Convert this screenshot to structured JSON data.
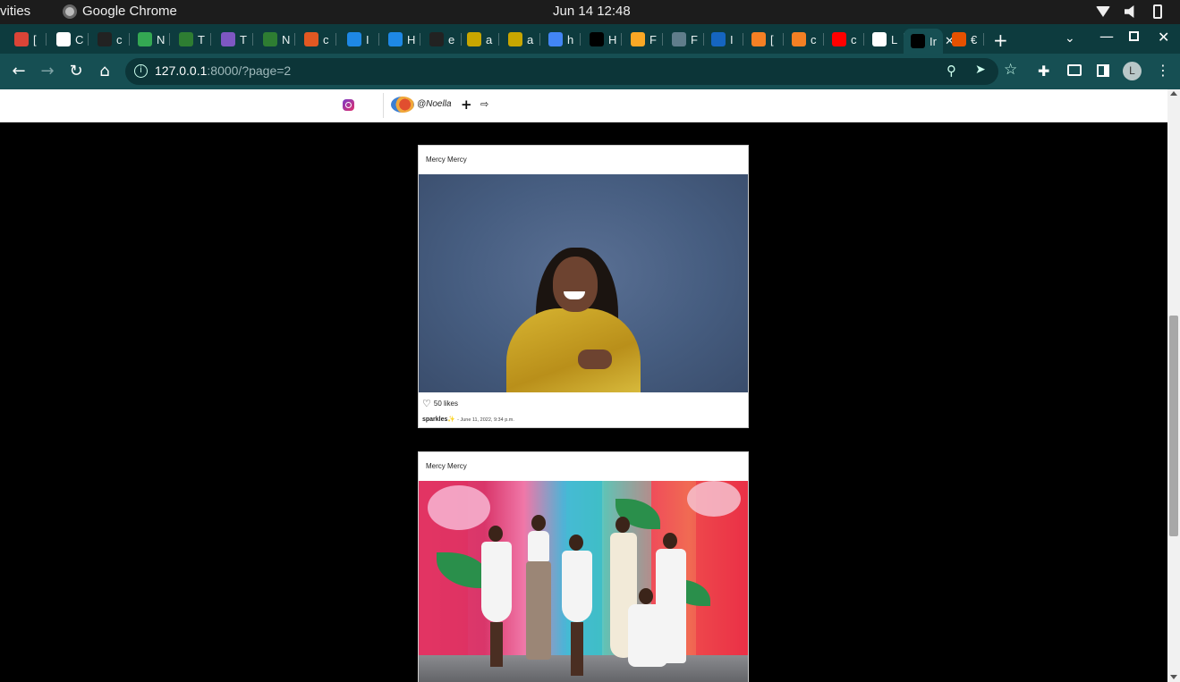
{
  "os": {
    "activities": "vities",
    "app_name": "Google Chrome",
    "clock": "Jun 14  12:48"
  },
  "tabs": [
    {
      "letter": "[",
      "color": "#db4437"
    },
    {
      "letter": "C",
      "color": "#ffffff"
    },
    {
      "letter": "c",
      "color": "#222222"
    },
    {
      "letter": "N",
      "color": "#34a853"
    },
    {
      "letter": "T",
      "color": "#2e7d32"
    },
    {
      "letter": "T",
      "color": "#7e57c2"
    },
    {
      "letter": "N",
      "color": "#2e7d32"
    },
    {
      "letter": "c",
      "color": "#e25822"
    },
    {
      "letter": "I",
      "color": "#1e88e5"
    },
    {
      "letter": "H",
      "color": "#1e88e5"
    },
    {
      "letter": "e",
      "color": "#222222"
    },
    {
      "letter": "a",
      "color": "#c8a600"
    },
    {
      "letter": "a",
      "color": "#c8a600"
    },
    {
      "letter": "h",
      "color": "#4285f4"
    },
    {
      "letter": "H",
      "color": "#000000"
    },
    {
      "letter": "F",
      "color": "#f9a825"
    },
    {
      "letter": "F",
      "color": "#607d8b"
    },
    {
      "letter": "I",
      "color": "#1565c0"
    },
    {
      "letter": "[",
      "color": "#f48024"
    },
    {
      "letter": "c",
      "color": "#f48024"
    },
    {
      "letter": "c",
      "color": "#ff0000"
    },
    {
      "letter": "L",
      "color": "#ffffff"
    },
    {
      "letter": "Ir",
      "color": "#000000",
      "active": true
    },
    {
      "letter": "€",
      "color": "#e65100"
    }
  ],
  "toolbar": {
    "url_host": "127.0.0.1",
    "url_rest": ":8000/?page=2",
    "profile_initial": "L"
  },
  "site_nav": {
    "username": "@Noella",
    "plus": "+",
    "logout": "⇨"
  },
  "posts": [
    {
      "author": "Mercy Mercy",
      "likes": "50 likes",
      "caption_user": "sparkles✨",
      "caption_date": "- June 11, 2022, 9:34 p.m."
    },
    {
      "author": "Mercy Mercy"
    }
  ],
  "colors": {
    "tab_strip": "#0d3b3e",
    "toolbar": "#164f53",
    "page_bg": "#000000"
  }
}
